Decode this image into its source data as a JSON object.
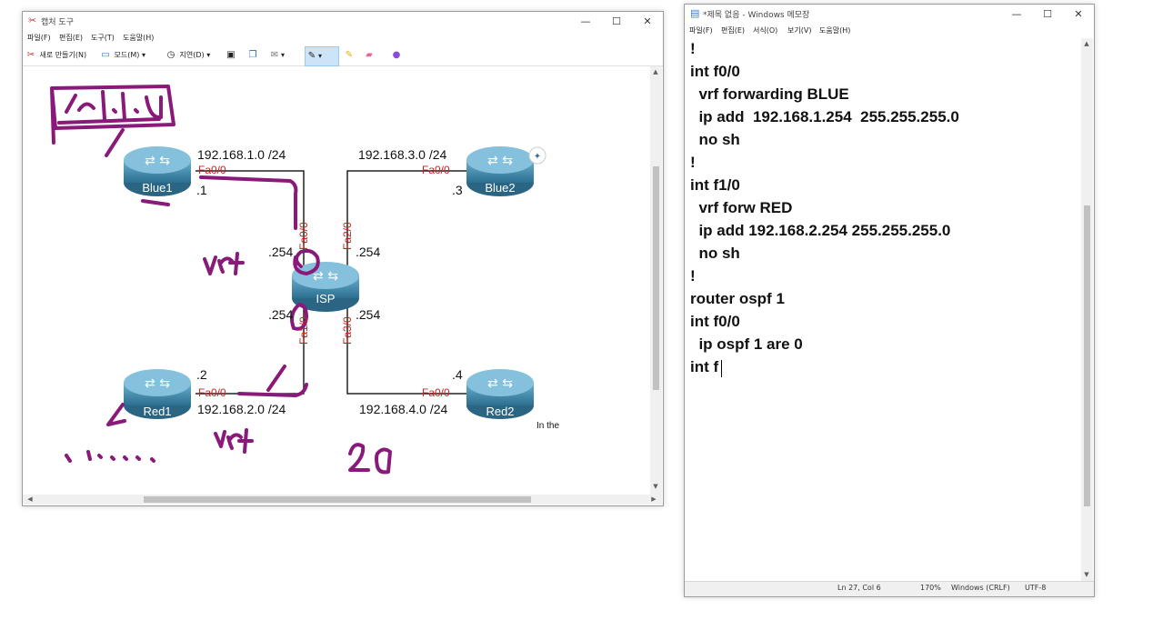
{
  "snipping": {
    "title": "캡처 도구",
    "menu": [
      "파일(F)",
      "편집(E)",
      "도구(T)",
      "도움말(H)"
    ],
    "toolbar": {
      "new_label": "새로 만들기(N)",
      "mode_label": "모드(M)",
      "delay_label": "지연(D)"
    },
    "diagram": {
      "labels": {
        "net1": "192.168.1.0 /24",
        "net3": "192.168.3.0 /24",
        "net2": "192.168.2.0 /24",
        "net4": "192.168.4.0 /24",
        "blue1_host": ".1",
        "blue2_host": ".3",
        "red1_host": ".2",
        "red2_host": ".4",
        "isp_tl": ".254",
        "isp_tr": ".254",
        "isp_bl": ".254",
        "isp_br": ".254",
        "caption": "In the"
      },
      "ports": {
        "blue1": "Fa0/0",
        "blue2": "Fa0/0",
        "red1": "Fa0/0",
        "red2": "Fa0/0",
        "isp_fa0": "Fa0/0",
        "isp_fa1": "Fa1/0",
        "isp_fa2": "Fa2/0",
        "isp_fa3": "Fa3/0"
      },
      "routers": {
        "blue1": "Blue1",
        "blue2": "Blue2",
        "red1": "Red1",
        "red2": "Red2",
        "isp": "ISP"
      }
    }
  },
  "notepad": {
    "title": "*제목 없음 - Windows 메모장",
    "menu": [
      "파일(F)",
      "편집(E)",
      "서식(O)",
      "보기(V)",
      "도움말(H)"
    ],
    "lines": [
      "!",
      "int f0/0",
      "  vrf forwarding BLUE",
      "  ip add  192.168.1.254  255.255.255.0",
      "  no sh",
      "!",
      "int f1/0",
      "  vrf forw RED",
      "  ip add 192.168.2.254 255.255.255.0",
      "  no sh",
      "!",
      "router ospf 1",
      "int f0/0",
      "  ip ospf 1 are 0",
      "int f"
    ],
    "status": {
      "position": "Ln 27, Col 6",
      "zoom": "170%",
      "eol": "Windows (CRLF)",
      "encoding": "UTF-8"
    }
  },
  "colors": {
    "port_label": "#d02020",
    "ink": "#8a1a7a",
    "router_body": "#3d86a8"
  }
}
